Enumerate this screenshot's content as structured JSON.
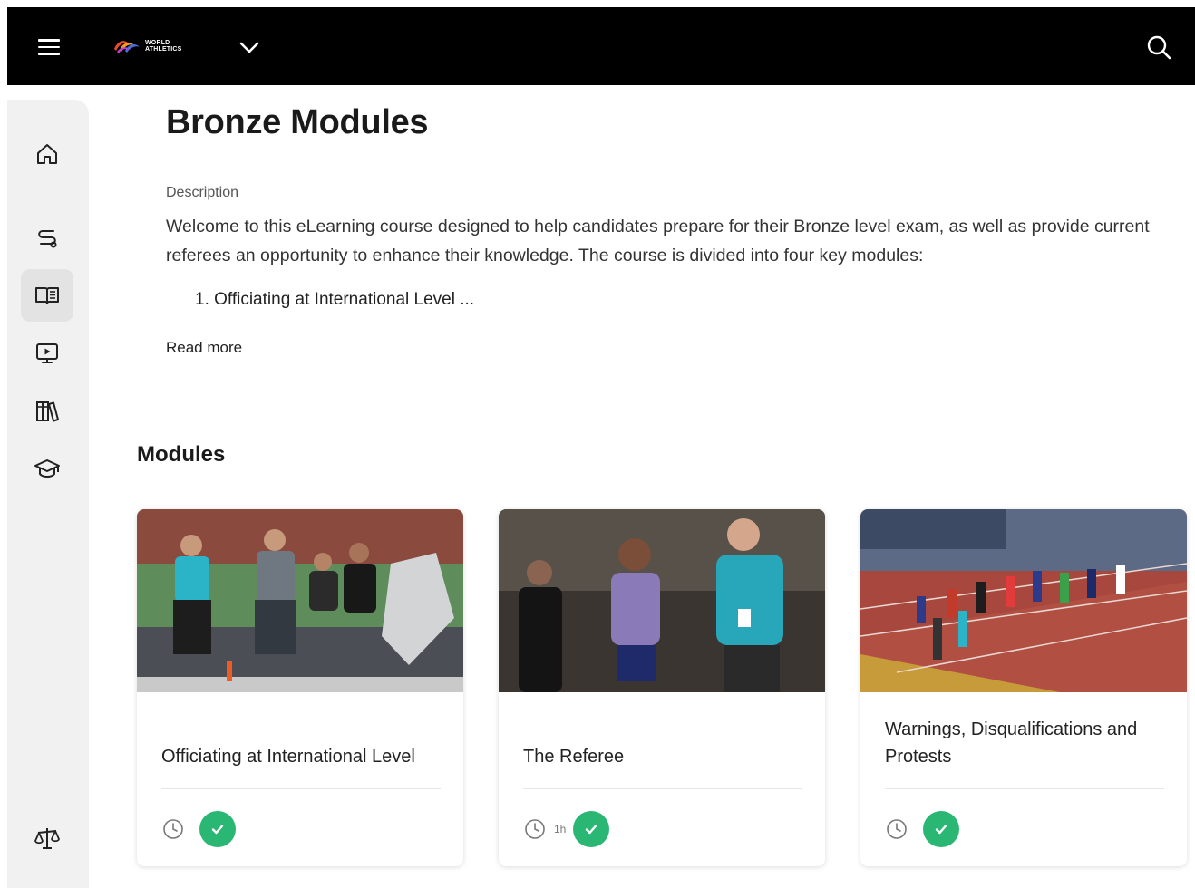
{
  "header": {
    "logo_text_line1": "WORLD",
    "logo_text_line2": "ATHLETICS"
  },
  "sidebar": {
    "items": [
      {
        "name": "home",
        "icon": "home-icon"
      },
      {
        "name": "learning-paths",
        "icon": "route-icon"
      },
      {
        "name": "courses",
        "icon": "book-icon"
      },
      {
        "name": "videos",
        "icon": "video-screen-icon"
      },
      {
        "name": "library",
        "icon": "books-icon"
      },
      {
        "name": "education",
        "icon": "graduation-cap-icon"
      },
      {
        "name": "rules",
        "icon": "scales-icon"
      }
    ],
    "active_item": "courses"
  },
  "page": {
    "title": "Bronze Modules",
    "description_label": "Description",
    "description": "Welcome to this eLearning course designed to help candidates prepare for their Bronze level exam, as well as provide current referees an opportunity to enhance their knowledge. The course is divided into four key modules:",
    "description_list_item": "1. Officiating at International Level ...",
    "read_more": "Read more",
    "modules_heading": "Modules"
  },
  "modules": [
    {
      "title": "Officiating at International Level",
      "duration": "",
      "completed": true
    },
    {
      "title": "The Referee",
      "duration": "1h",
      "completed": true
    },
    {
      "title": "Warnings, Disqualifications and Protests",
      "duration": "",
      "completed": true
    }
  ],
  "colors": {
    "topbar": "#000000",
    "sidebar": "#f1f1f1",
    "complete_green": "#2ab673"
  }
}
